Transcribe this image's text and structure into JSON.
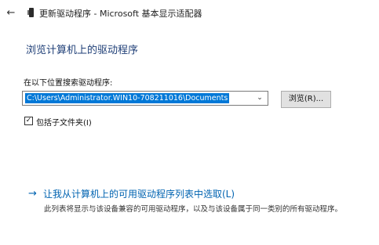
{
  "window": {
    "title": "更新驱动程序 - Microsoft 基本显示适配器",
    "back_glyph": "←"
  },
  "main": {
    "heading": "浏览计算机上的驱动程序",
    "search_label": "在以下位置搜索驱动程序:",
    "path_value": "C:\\Users\\Administrator.WIN10-708211016\\Documents",
    "combo_arrow_glyph": "⌄",
    "browse_label": "浏览(R)...",
    "include_subfolders": {
      "label": "包括子文件夹(I)",
      "checked": true,
      "check_glyph": "✓"
    },
    "pick_link": {
      "arrow_glyph": "→",
      "label": "让我从计算机上的可用驱动程序列表中选取(L)",
      "description": "此列表将显示与该设备兼容的可用驱动程序，以及与该设备属于同一类别的所有驱动程序。"
    }
  },
  "colors": {
    "heading": "#1f3f77",
    "link": "#0063b1",
    "selection": "#0078d7"
  },
  "icons": {
    "back": "back-arrow-icon",
    "app": "device-icon",
    "combo": "chevron-down-icon",
    "link": "arrow-right-icon"
  }
}
